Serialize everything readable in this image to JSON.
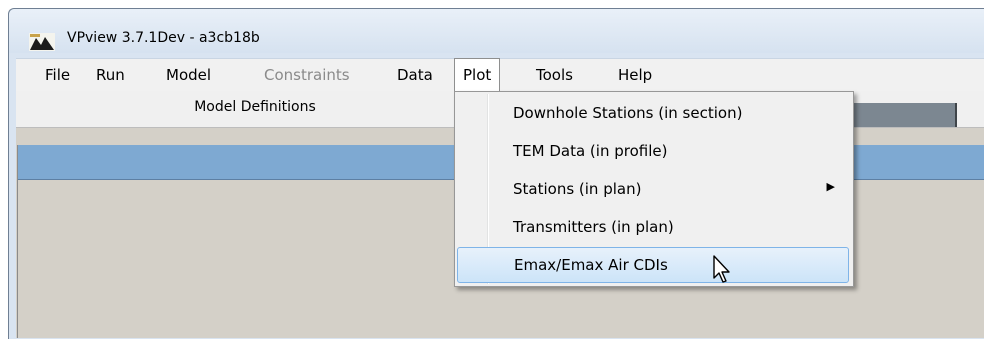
{
  "window": {
    "title": "VPview 3.7.1Dev - a3cb18b",
    "app_icon": "vpview-logo-icon"
  },
  "menubar": {
    "items": [
      {
        "label": "File",
        "enabled": true
      },
      {
        "label": "Run",
        "enabled": true
      },
      {
        "label": "Model",
        "enabled": true
      },
      {
        "label": "Constraints",
        "enabled": false
      },
      {
        "label": "Data",
        "enabled": true
      },
      {
        "label": "Plot",
        "enabled": true,
        "open": true
      },
      {
        "label": "Tools",
        "enabled": true
      },
      {
        "label": "Help",
        "enabled": true
      }
    ]
  },
  "tabs": {
    "active_label": "Model Definitions"
  },
  "plot_menu": {
    "items": [
      {
        "label": "Downhole Stations (in section)"
      },
      {
        "label": "TEM Data (in profile)"
      },
      {
        "label": "Stations (in plan)",
        "submenu": true,
        "arrow": "▶"
      },
      {
        "label": "Transmitters (in plan)"
      },
      {
        "label": "Emax/Emax Air CDIs",
        "highlighted": true
      }
    ]
  },
  "colors": {
    "panel_header": "#7ea9d2",
    "highlight": "#cce4f8",
    "disabled_text": "#8a8a8a"
  }
}
